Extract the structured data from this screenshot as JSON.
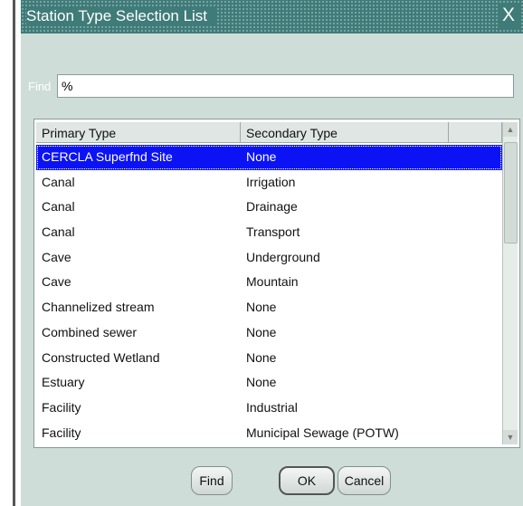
{
  "window": {
    "title": "Station Type Selection List",
    "close_glyph": "X"
  },
  "find": {
    "label": "Find",
    "value": "%"
  },
  "table": {
    "columns": [
      "Primary Type",
      "Secondary Type"
    ],
    "selected_index": 0,
    "rows": [
      [
        "CERCLA Superfnd Site",
        "None"
      ],
      [
        "Canal",
        "Irrigation"
      ],
      [
        "Canal",
        "Drainage"
      ],
      [
        "Canal",
        "Transport"
      ],
      [
        "Cave",
        "Underground"
      ],
      [
        "Cave",
        "Mountain"
      ],
      [
        "Channelized stream",
        "None"
      ],
      [
        "Combined sewer",
        "None"
      ],
      [
        "Constructed Wetland",
        "None"
      ],
      [
        "Estuary",
        "None"
      ],
      [
        "Facility",
        "Industrial"
      ],
      [
        "Facility",
        "Municipal Sewage (POTW)"
      ]
    ]
  },
  "buttons": {
    "find": "Find",
    "ok": "OK",
    "cancel": "Cancel"
  },
  "colors": {
    "titlebar": "#3f7b79",
    "dialog_bg": "#cfddd9",
    "selection": "#0b13f5"
  }
}
